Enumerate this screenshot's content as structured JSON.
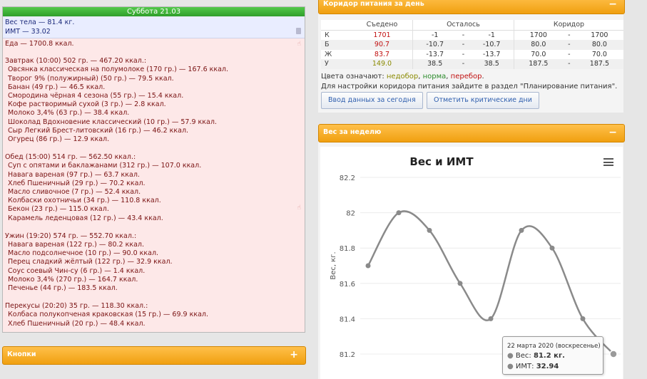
{
  "day": {
    "title": "Суббота 21.03",
    "weight": "Вес тела — 81.4 кг.",
    "bmi": "ИМТ — 33.02",
    "food_total": "Еда — 1700.8 ккал.",
    "meals": [
      {
        "header": "Завтрак (10:00) 502 гр. — 467.20 ккал.:",
        "items": [
          "Овсянка классическая на полумолоке (170 гр.) — 167.6 ккал.",
          "Творог 9% (полужирный) (50 гр.) — 79.5 ккал.",
          "Банан (49 гр.) — 46.5 ккал.",
          "Смородина чёрная 4 сезона (55 гр.) — 15.4 ккал.",
          "Кофе растворимый сухой (3 гр.) — 2.8 ккал.",
          "Молоко 3,4% (63 гр.) — 38.4 ккал.",
          "Шоколад Вдохновение классический (10 гр.) — 57.9 ккал.",
          "Сыр Легкий Брест-литовский (16 гр.) — 46.2 ккал.",
          "Огурец (86 гр.) — 12.9 ккал."
        ]
      },
      {
        "header": "Обед (15:00) 514 гр. — 562.50 ккал.:",
        "items": [
          "Суп с опятами и баклажанами (312 гр.) — 107.0 ккал.",
          "Навага вареная (97 гр.) — 63.7 ккал.",
          "Хлеб Пшеничный (29 гр.) — 70.2 ккал.",
          "Масло сливочное (7 гр.) — 52.4 ккал.",
          "Колбаски охотничьи (34 гр.) — 110.8 ккал.",
          "Бекон (23 гр.) — 115.0 ккал.",
          "Карамель леденцовая (12 гр.) — 43.4 ккал."
        ]
      },
      {
        "header": "Ужин (19:20) 574 гр. — 552.70 ккал.:",
        "items": [
          "Навага вареная (122 гр.) — 80.2 ккал.",
          "Масло подсолнечное (10 гр.) — 90.0 ккал.",
          "Перец сладкий жёлтый (122 гр.) — 32.9 ккал.",
          "Соус соевый Чин-су (6 гр.) — 1.4 ккал.",
          "Молоко 3,4% (270 гр.) — 164.7 ккал.",
          "Печенье (44 гр.) — 183.5 ккал."
        ]
      },
      {
        "header": "Перекусы (20:20) 35 гр. — 118.30 ккал.:",
        "items": [
          "Колбаса полукопченая краковская (15 гр.) — 69.9 ккал.",
          "Хлеб Пшеничный (20 гр.) — 48.4 ккал."
        ]
      }
    ]
  },
  "buttons_panel": {
    "title": "Кнопки",
    "toggle": "+"
  },
  "corridor": {
    "title": "Коридор питания за день",
    "toggle": "−",
    "headers": {
      "eaten": "Съедено",
      "left": "Осталось",
      "corridor": "Коридор"
    },
    "rows": [
      {
        "label": "К",
        "eaten": "1701",
        "eaten_color": "#c01010",
        "left_min": "-1",
        "left_max": "-1",
        "cor_min": "1700",
        "cor_max": "1700"
      },
      {
        "label": "Б",
        "eaten": "90.7",
        "eaten_color": "#c01010",
        "left_min": "-10.7",
        "left_max": "-10.7",
        "cor_min": "80.0",
        "cor_max": "80.0"
      },
      {
        "label": "Ж",
        "eaten": "83.7",
        "eaten_color": "#c01010",
        "left_min": "-13.7",
        "left_max": "-13.7",
        "cor_min": "70.0",
        "cor_max": "70.0"
      },
      {
        "label": "У",
        "eaten": "149.0",
        "eaten_color": "#8a8a00",
        "left_min": "38.5",
        "left_max": "38.5",
        "cor_min": "187.5",
        "cor_max": "187.5"
      }
    ],
    "dash": "-",
    "legend": {
      "prefix": "Цвета означают:",
      "under": "недобор",
      "norm": "норма",
      "over": "перебор",
      "under_color": "#8a8a00",
      "norm_color": "#2a8a2a",
      "over_color": "#c01010"
    },
    "hint": "Для настройки коридора питания зайдите в раздел \"Планирование питания\".",
    "btn_today": "Ввод данных за сегодня",
    "btn_critical": "Отметить критические дни"
  },
  "weight_panel": {
    "title": "Вес за неделю",
    "toggle": "−"
  },
  "chart_data": {
    "type": "line",
    "title": "Вес и ИМТ",
    "ylabel": "Вес, кг.",
    "xlabel": "",
    "ylim": [
      81.2,
      82.2
    ],
    "yticks": [
      "82.2",
      "82",
      "81.8",
      "81.6",
      "81.4",
      "81.2"
    ],
    "series": [
      {
        "values": [
          81.7,
          82.0,
          81.9,
          81.6,
          81.4,
          81.9,
          81.8,
          81.4,
          81.2
        ]
      }
    ],
    "line_color": "#8a8a8a",
    "tooltip": {
      "date": "22 марта 2020 (воскресенье)",
      "weight_label": "Вес:",
      "weight_value": "81.2 кг.",
      "bmi_label": "ИМТ:",
      "bmi_value": "32.94"
    }
  }
}
